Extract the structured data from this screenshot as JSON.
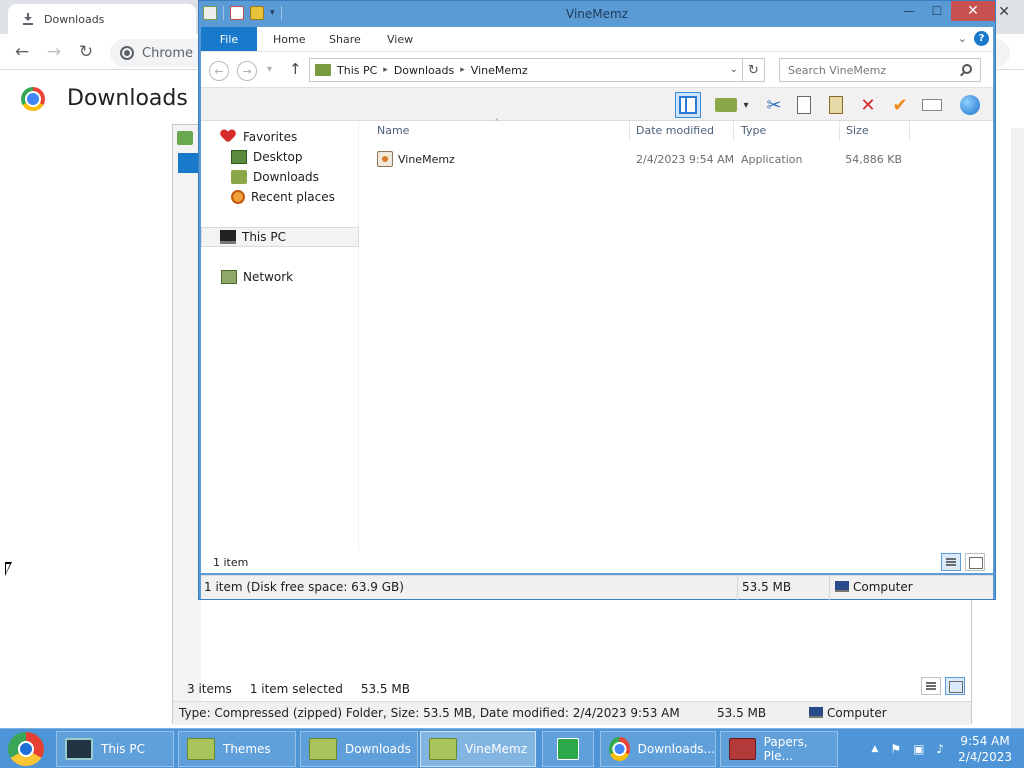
{
  "chrome": {
    "tab_title": "Downloads",
    "tab_close": "✕",
    "omnibox_text": "Chrome",
    "page_title": "Downloads"
  },
  "back_window": {
    "status_items": "3 items",
    "status_selected": "1 item selected",
    "status_size": "53.5 MB",
    "statusbar_type": "Type: Compressed (zipped) Folder, Size: 53.5 MB, Date modified: 2/4/2023 9:53 AM",
    "statusbar_size": "53.5 MB",
    "statusbar_location": "Computer"
  },
  "explorer": {
    "title": "VineMemz",
    "caption": {
      "minimize": "—",
      "maximize": "☐",
      "close": "✕"
    },
    "ribbon_tabs": [
      "File",
      "Home",
      "Share",
      "View"
    ],
    "help": "?",
    "breadcrumb": [
      "This PC",
      "Downloads",
      "VineMemz"
    ],
    "search_placeholder": "Search VineMemz",
    "nav": {
      "favorites": "Favorites",
      "desktop": "Desktop",
      "downloads": "Downloads",
      "recent": "Recent places",
      "this_pc": "This PC",
      "network": "Network"
    },
    "columns": {
      "name": "Name",
      "date": "Date modified",
      "type": "Type",
      "size": "Size"
    },
    "files": [
      {
        "name": "VineMemz",
        "date": "2/4/2023 9:54 AM",
        "type": "Application",
        "size": "54,886 KB"
      }
    ],
    "item_count": "1 item",
    "status_left": "1 item (Disk free space: 63.9 GB)",
    "status_size": "53.5 MB",
    "status_location": "Computer"
  },
  "taskbar": {
    "buttons": [
      "This PC",
      "Themes",
      "Downloads",
      "VineMemz",
      "",
      "Downloads...",
      "Papers, Ple..."
    ],
    "clock_time": "9:54 AM",
    "clock_date": "2/4/2023"
  }
}
